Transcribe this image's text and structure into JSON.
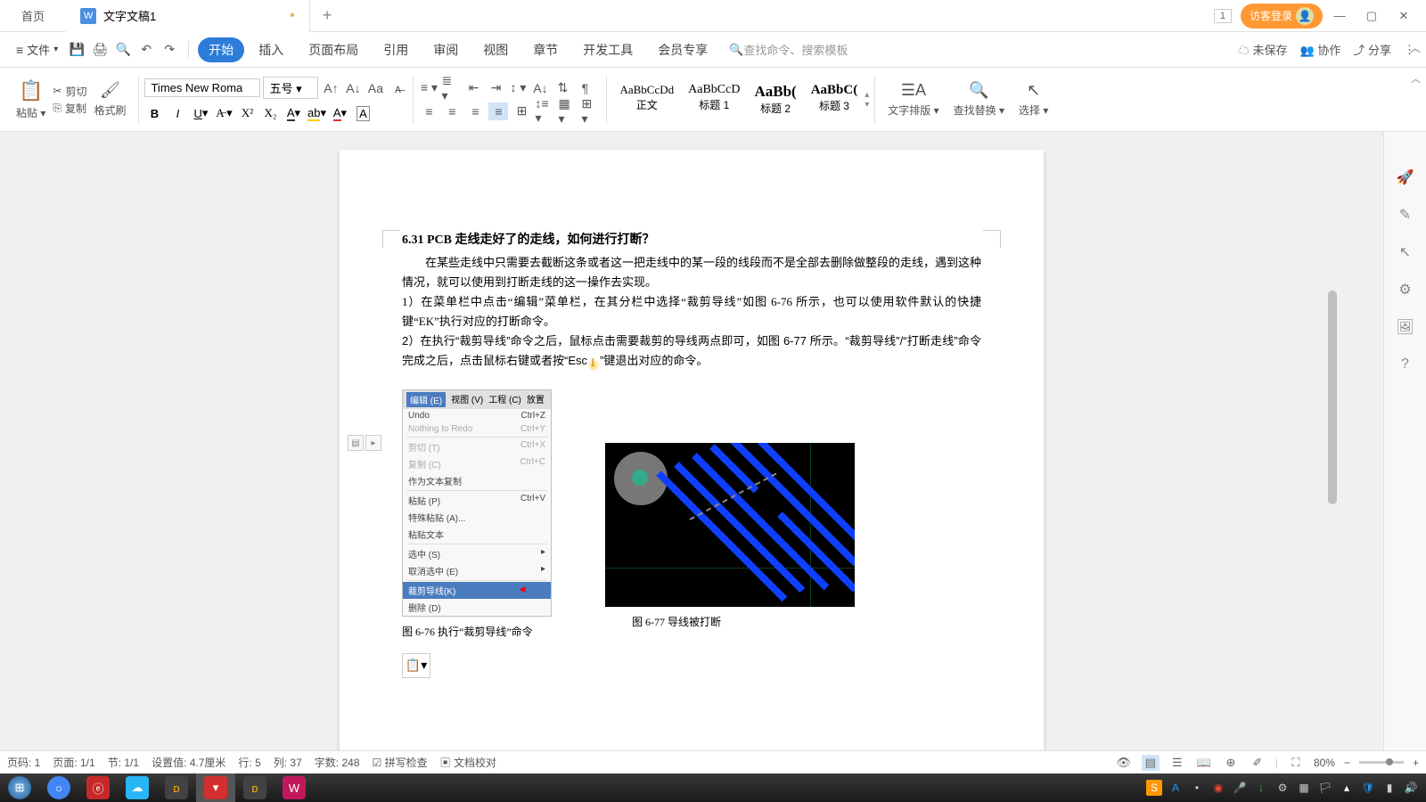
{
  "titlebar": {
    "home_tab": "首页",
    "doc_tab": "文字文稿1",
    "doc_icon_letter": "W",
    "count": "1",
    "login": "访客登录"
  },
  "menubar": {
    "file": "文件",
    "tabs": {
      "start": "开始",
      "insert": "插入",
      "layout": "页面布局",
      "ref": "引用",
      "review": "审阅",
      "view": "视图",
      "chapter": "章节",
      "devtools": "开发工具",
      "member": "会员专享"
    },
    "search_placeholder": "查找命令、搜索模板",
    "unsaved": "未保存",
    "collab": "协作",
    "share": "分享"
  },
  "ribbon": {
    "paste": "粘贴",
    "cut": "剪切",
    "copy": "复制",
    "format_painter": "格式刷",
    "font_name": "Times New Roma",
    "font_size": "五号",
    "layout_btn": "文字排版",
    "find_replace": "查找替换",
    "select": "选择",
    "styles": {
      "body_preview": "AaBbCcDd",
      "body_label": "正文",
      "h1_preview": "AaBbCcD",
      "h1_label": "标题 1",
      "h2_preview": "AaBb(",
      "h2_label": "标题 2",
      "h3_preview": "AaBbC(",
      "h3_label": "标题 3"
    }
  },
  "document": {
    "heading": "6.31  PCB 走线走好了的走线，如何进行打断？",
    "para1": "在某些走线中只需要去截断这条或者这一把走线中的某一段的线段而不是全部去删除做整段的走线，遇到这种情况，就可以使用到打断走线的这一操作去实现。",
    "para2": "1）在菜单栏中点击“编辑”菜单栏，在其分栏中选择“裁剪导线”如图 6-76 所示，也可以使用软件默认的快捷键“EK”执行对应的打断命令。",
    "para3_a": "2）在执行“裁剪导线”命令之后，鼠标点击需要裁剪的导线两点即可，如图 6-77 所示。“裁剪导线”/“打断走线”命令完成之后，点击鼠标右键或者按“",
    "para3_esc": "Esc",
    "para3_b": "”键退出对应的命令。",
    "fig1_top": [
      "编辑 (E)",
      "视图 (V)",
      "工程 (C)",
      "放置"
    ],
    "fig1_items": [
      {
        "t": "Undo",
        "k": "Ctrl+Z"
      },
      {
        "t": "Nothing to Redo",
        "k": "Ctrl+Y",
        "gray": true
      },
      {
        "t": "剪切 (T)",
        "k": "Ctrl+X",
        "gray": true
      },
      {
        "t": "复制 (C)",
        "k": "Ctrl+C",
        "gray": true
      },
      {
        "t": "作为文本复制",
        "k": ""
      },
      {
        "t": "粘贴 (P)",
        "k": "Ctrl+V"
      },
      {
        "t": "特殊粘贴 (A)...",
        "k": ""
      },
      {
        "t": "粘贴文本",
        "k": ""
      },
      {
        "t": "选中 (S)",
        "k": "▸"
      },
      {
        "t": "取消选中 (E)",
        "k": "▸"
      },
      {
        "t": "裁剪导线(K)",
        "k": "",
        "sel": true
      },
      {
        "t": "删除 (D)",
        "k": ""
      }
    ],
    "fig1_caption": "图 6-76 执行“裁剪导线”命令",
    "fig2_caption": "图 6-77 导线被打断"
  },
  "statusbar": {
    "page_label": "页码: 1",
    "page_of": "页面: 1/1",
    "section": "节: 1/1",
    "setvalue": "设置值: 4.7厘米",
    "row": "行: 5",
    "col": "列: 37",
    "words": "字数: 248",
    "spell": "拼写检查",
    "proof": "文档校对",
    "zoom": "80%"
  },
  "taskbar": {
    "time": "",
    "tray": [
      "S",
      "A",
      "·",
      "◉",
      "●",
      "↓",
      "⚙",
      "☁"
    ]
  }
}
